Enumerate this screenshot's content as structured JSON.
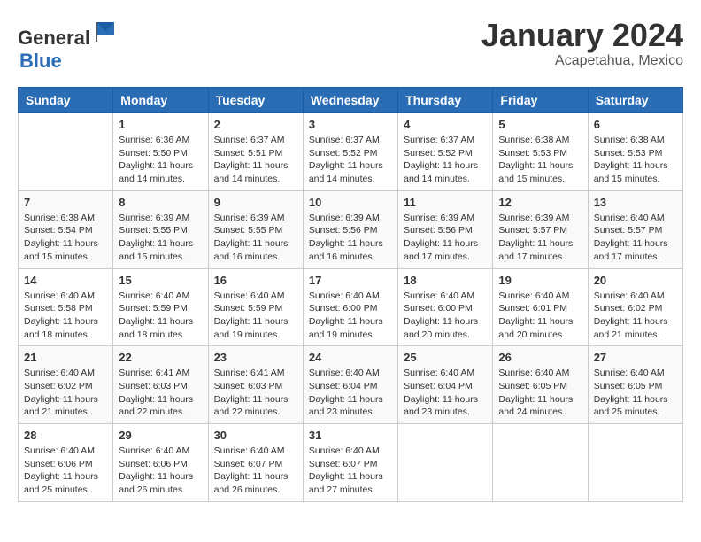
{
  "logo": {
    "general": "General",
    "blue": "Blue"
  },
  "header": {
    "month": "January 2024",
    "location": "Acapetahua, Mexico"
  },
  "columns": [
    "Sunday",
    "Monday",
    "Tuesday",
    "Wednesday",
    "Thursday",
    "Friday",
    "Saturday"
  ],
  "weeks": [
    [
      {
        "day": "",
        "sunrise": "",
        "sunset": "",
        "daylight": ""
      },
      {
        "day": "1",
        "sunrise": "Sunrise: 6:36 AM",
        "sunset": "Sunset: 5:50 PM",
        "daylight": "Daylight: 11 hours and 14 minutes."
      },
      {
        "day": "2",
        "sunrise": "Sunrise: 6:37 AM",
        "sunset": "Sunset: 5:51 PM",
        "daylight": "Daylight: 11 hours and 14 minutes."
      },
      {
        "day": "3",
        "sunrise": "Sunrise: 6:37 AM",
        "sunset": "Sunset: 5:52 PM",
        "daylight": "Daylight: 11 hours and 14 minutes."
      },
      {
        "day": "4",
        "sunrise": "Sunrise: 6:37 AM",
        "sunset": "Sunset: 5:52 PM",
        "daylight": "Daylight: 11 hours and 14 minutes."
      },
      {
        "day": "5",
        "sunrise": "Sunrise: 6:38 AM",
        "sunset": "Sunset: 5:53 PM",
        "daylight": "Daylight: 11 hours and 15 minutes."
      },
      {
        "day": "6",
        "sunrise": "Sunrise: 6:38 AM",
        "sunset": "Sunset: 5:53 PM",
        "daylight": "Daylight: 11 hours and 15 minutes."
      }
    ],
    [
      {
        "day": "7",
        "sunrise": "Sunrise: 6:38 AM",
        "sunset": "Sunset: 5:54 PM",
        "daylight": "Daylight: 11 hours and 15 minutes."
      },
      {
        "day": "8",
        "sunrise": "Sunrise: 6:39 AM",
        "sunset": "Sunset: 5:55 PM",
        "daylight": "Daylight: 11 hours and 15 minutes."
      },
      {
        "day": "9",
        "sunrise": "Sunrise: 6:39 AM",
        "sunset": "Sunset: 5:55 PM",
        "daylight": "Daylight: 11 hours and 16 minutes."
      },
      {
        "day": "10",
        "sunrise": "Sunrise: 6:39 AM",
        "sunset": "Sunset: 5:56 PM",
        "daylight": "Daylight: 11 hours and 16 minutes."
      },
      {
        "day": "11",
        "sunrise": "Sunrise: 6:39 AM",
        "sunset": "Sunset: 5:56 PM",
        "daylight": "Daylight: 11 hours and 17 minutes."
      },
      {
        "day": "12",
        "sunrise": "Sunrise: 6:39 AM",
        "sunset": "Sunset: 5:57 PM",
        "daylight": "Daylight: 11 hours and 17 minutes."
      },
      {
        "day": "13",
        "sunrise": "Sunrise: 6:40 AM",
        "sunset": "Sunset: 5:57 PM",
        "daylight": "Daylight: 11 hours and 17 minutes."
      }
    ],
    [
      {
        "day": "14",
        "sunrise": "Sunrise: 6:40 AM",
        "sunset": "Sunset: 5:58 PM",
        "daylight": "Daylight: 11 hours and 18 minutes."
      },
      {
        "day": "15",
        "sunrise": "Sunrise: 6:40 AM",
        "sunset": "Sunset: 5:59 PM",
        "daylight": "Daylight: 11 hours and 18 minutes."
      },
      {
        "day": "16",
        "sunrise": "Sunrise: 6:40 AM",
        "sunset": "Sunset: 5:59 PM",
        "daylight": "Daylight: 11 hours and 19 minutes."
      },
      {
        "day": "17",
        "sunrise": "Sunrise: 6:40 AM",
        "sunset": "Sunset: 6:00 PM",
        "daylight": "Daylight: 11 hours and 19 minutes."
      },
      {
        "day": "18",
        "sunrise": "Sunrise: 6:40 AM",
        "sunset": "Sunset: 6:00 PM",
        "daylight": "Daylight: 11 hours and 20 minutes."
      },
      {
        "day": "19",
        "sunrise": "Sunrise: 6:40 AM",
        "sunset": "Sunset: 6:01 PM",
        "daylight": "Daylight: 11 hours and 20 minutes."
      },
      {
        "day": "20",
        "sunrise": "Sunrise: 6:40 AM",
        "sunset": "Sunset: 6:02 PM",
        "daylight": "Daylight: 11 hours and 21 minutes."
      }
    ],
    [
      {
        "day": "21",
        "sunrise": "Sunrise: 6:40 AM",
        "sunset": "Sunset: 6:02 PM",
        "daylight": "Daylight: 11 hours and 21 minutes."
      },
      {
        "day": "22",
        "sunrise": "Sunrise: 6:41 AM",
        "sunset": "Sunset: 6:03 PM",
        "daylight": "Daylight: 11 hours and 22 minutes."
      },
      {
        "day": "23",
        "sunrise": "Sunrise: 6:41 AM",
        "sunset": "Sunset: 6:03 PM",
        "daylight": "Daylight: 11 hours and 22 minutes."
      },
      {
        "day": "24",
        "sunrise": "Sunrise: 6:40 AM",
        "sunset": "Sunset: 6:04 PM",
        "daylight": "Daylight: 11 hours and 23 minutes."
      },
      {
        "day": "25",
        "sunrise": "Sunrise: 6:40 AM",
        "sunset": "Sunset: 6:04 PM",
        "daylight": "Daylight: 11 hours and 23 minutes."
      },
      {
        "day": "26",
        "sunrise": "Sunrise: 6:40 AM",
        "sunset": "Sunset: 6:05 PM",
        "daylight": "Daylight: 11 hours and 24 minutes."
      },
      {
        "day": "27",
        "sunrise": "Sunrise: 6:40 AM",
        "sunset": "Sunset: 6:05 PM",
        "daylight": "Daylight: 11 hours and 25 minutes."
      }
    ],
    [
      {
        "day": "28",
        "sunrise": "Sunrise: 6:40 AM",
        "sunset": "Sunset: 6:06 PM",
        "daylight": "Daylight: 11 hours and 25 minutes."
      },
      {
        "day": "29",
        "sunrise": "Sunrise: 6:40 AM",
        "sunset": "Sunset: 6:06 PM",
        "daylight": "Daylight: 11 hours and 26 minutes."
      },
      {
        "day": "30",
        "sunrise": "Sunrise: 6:40 AM",
        "sunset": "Sunset: 6:07 PM",
        "daylight": "Daylight: 11 hours and 26 minutes."
      },
      {
        "day": "31",
        "sunrise": "Sunrise: 6:40 AM",
        "sunset": "Sunset: 6:07 PM",
        "daylight": "Daylight: 11 hours and 27 minutes."
      },
      {
        "day": "",
        "sunrise": "",
        "sunset": "",
        "daylight": ""
      },
      {
        "day": "",
        "sunrise": "",
        "sunset": "",
        "daylight": ""
      },
      {
        "day": "",
        "sunrise": "",
        "sunset": "",
        "daylight": ""
      }
    ]
  ]
}
